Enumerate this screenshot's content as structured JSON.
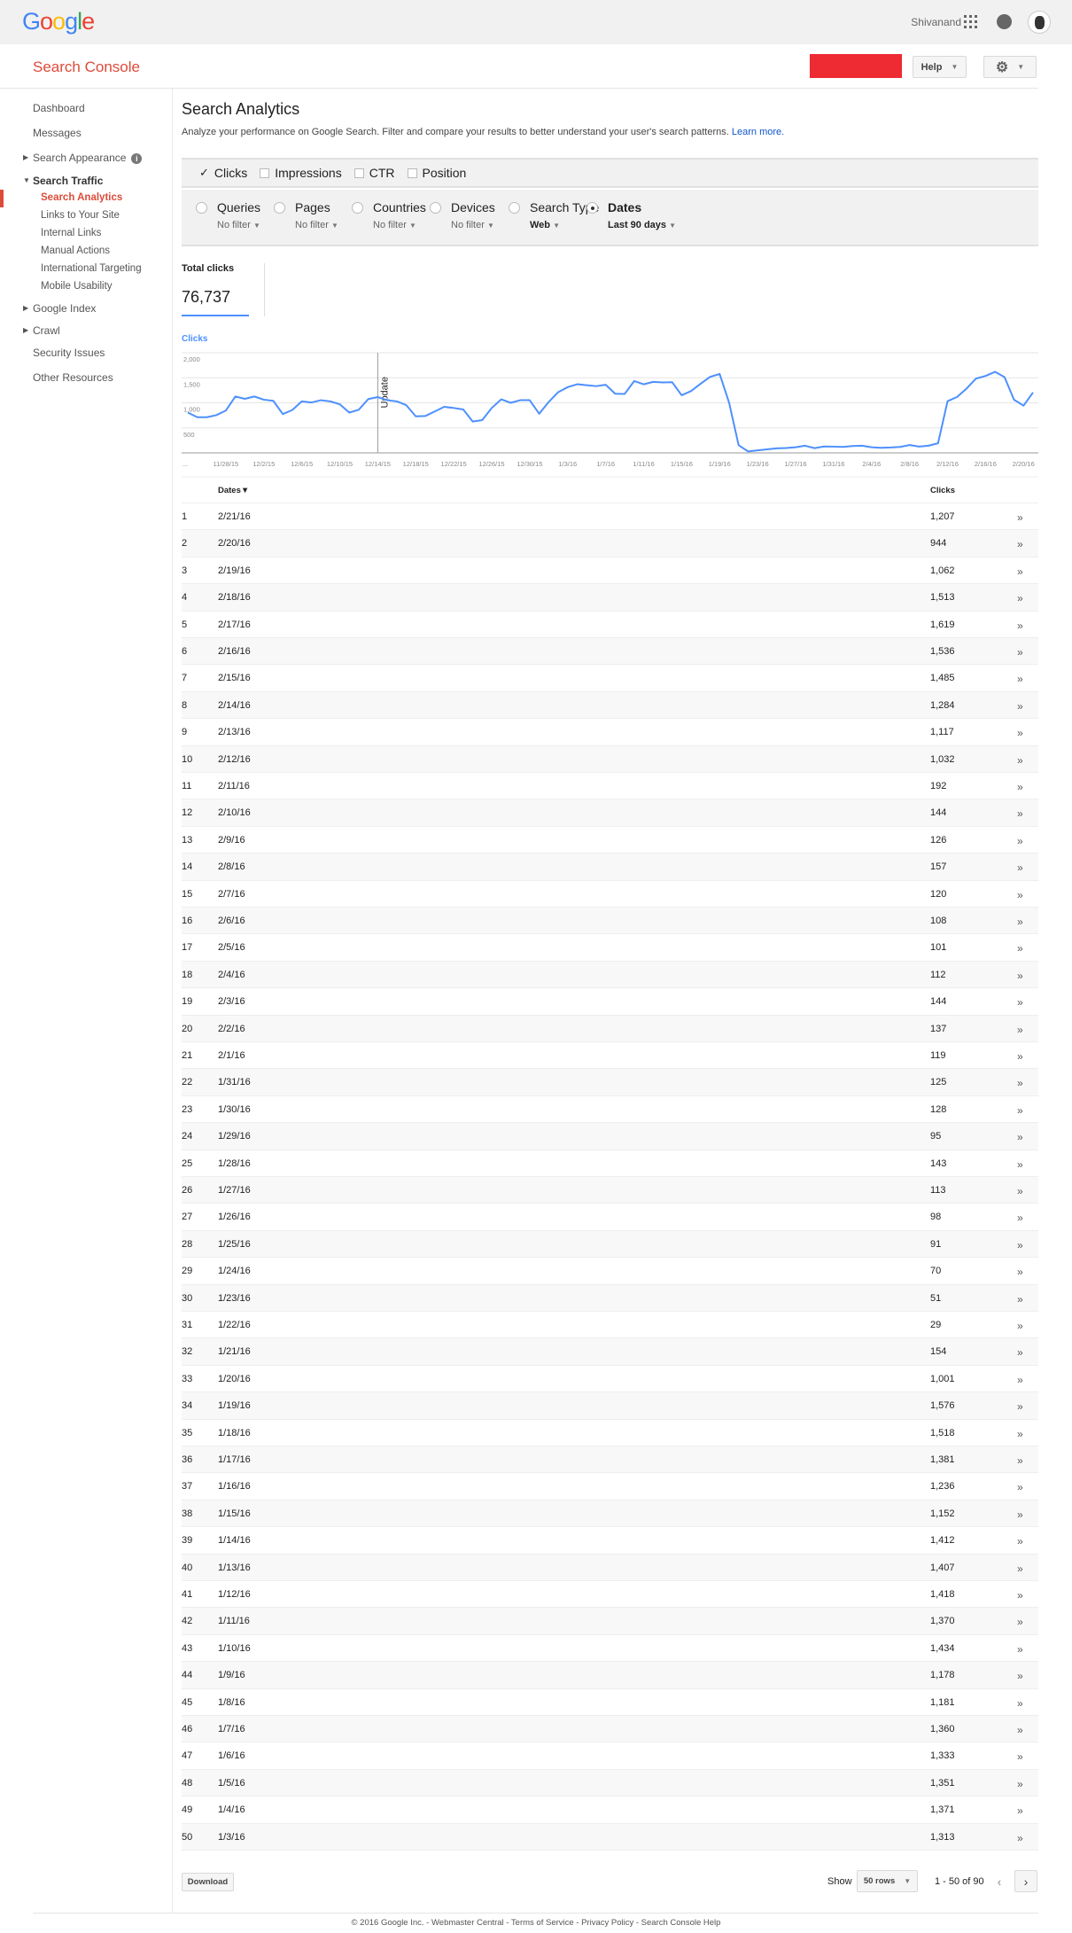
{
  "header": {
    "logo": "Google",
    "user_name": "Shivanand",
    "icons": [
      "apps-grid-icon",
      "notifications-icon",
      "avatar"
    ]
  },
  "console": {
    "title": "Search Console",
    "help_label": "Help",
    "settings_icon": "gear-icon",
    "brand_color": "#dd4b39"
  },
  "sidebar": {
    "dashboard": "Dashboard",
    "messages": "Messages",
    "search_appearance": "Search Appearance",
    "search_traffic": "Search Traffic",
    "traffic_items": [
      "Search Analytics",
      "Links to Your Site",
      "Internal Links",
      "Manual Actions",
      "International Targeting",
      "Mobile Usability"
    ],
    "google_index": "Google Index",
    "crawl": "Crawl",
    "security_issues": "Security Issues",
    "other_resources": "Other Resources"
  },
  "page": {
    "title": "Search Analytics",
    "description": "Analyze your performance on Google Search. Filter and compare your results to better understand your user's search patterns.",
    "learn_more": "Learn more."
  },
  "metrics": [
    {
      "label": "Clicks",
      "checked": true
    },
    {
      "label": "Impressions",
      "checked": false
    },
    {
      "label": "CTR",
      "checked": false
    },
    {
      "label": "Position",
      "checked": false
    }
  ],
  "filters": [
    {
      "label": "Queries",
      "value": "No filter",
      "selected": false
    },
    {
      "label": "Pages",
      "value": "No filter",
      "selected": false
    },
    {
      "label": "Countries",
      "value": "No filter",
      "selected": false
    },
    {
      "label": "Devices",
      "value": "No filter",
      "selected": false
    },
    {
      "label": "Search Type",
      "value": "Web",
      "selected": false
    },
    {
      "label": "Dates",
      "value": "Last 90 days",
      "selected": true
    }
  ],
  "summary": {
    "label": "Total clicks",
    "value": "76,737"
  },
  "chart_data": {
    "type": "line",
    "title": "",
    "series_label": "Clicks",
    "color": "#4d90fe",
    "ylim": [
      0,
      2000
    ],
    "yticks": [
      "2,000",
      "1,500",
      "1,000",
      "500"
    ],
    "grid": true,
    "xtick_first": "...",
    "xticks": [
      "11/28/15",
      "12/2/15",
      "12/6/15",
      "12/10/15",
      "12/14/15",
      "12/18/15",
      "12/22/15",
      "12/26/15",
      "12/30/15",
      "1/3/16",
      "1/7/16",
      "1/11/16",
      "1/15/16",
      "1/19/16",
      "1/23/16",
      "1/27/16",
      "1/31/16",
      "2/4/16",
      "2/8/16",
      "2/12/16",
      "2/16/16",
      "2/20/16"
    ],
    "annotation": {
      "date": "12/14/15",
      "label": "Update"
    },
    "x": [
      "11/24/15",
      "11/25/15",
      "11/26/15",
      "11/27/15",
      "11/28/15",
      "11/29/15",
      "11/30/15",
      "12/1/15",
      "12/2/15",
      "12/3/15",
      "12/4/15",
      "12/5/15",
      "12/6/15",
      "12/7/15",
      "12/8/15",
      "12/9/15",
      "12/10/15",
      "12/11/15",
      "12/12/15",
      "12/13/15",
      "12/14/15",
      "12/15/15",
      "12/16/15",
      "12/17/15",
      "12/18/15",
      "12/19/15",
      "12/20/15",
      "12/21/15",
      "12/22/15",
      "12/23/15",
      "12/24/15",
      "12/25/15",
      "12/26/15",
      "12/27/15",
      "12/28/15",
      "12/29/15",
      "12/30/15",
      "12/31/15",
      "1/1/16",
      "1/2/16",
      "1/3/16",
      "1/4/16",
      "1/5/16",
      "1/6/16",
      "1/7/16",
      "1/8/16",
      "1/9/16",
      "1/10/16",
      "1/11/16",
      "1/12/16",
      "1/13/16",
      "1/14/16",
      "1/15/16",
      "1/16/16",
      "1/17/16",
      "1/18/16",
      "1/19/16",
      "1/20/16",
      "1/21/16",
      "1/22/16",
      "1/23/16",
      "1/24/16",
      "1/25/16",
      "1/26/16",
      "1/27/16",
      "1/28/16",
      "1/29/16",
      "1/30/16",
      "1/31/16",
      "2/1/16",
      "2/2/16",
      "2/3/16",
      "2/4/16",
      "2/5/16",
      "2/6/16",
      "2/7/16",
      "2/8/16",
      "2/9/16",
      "2/10/16",
      "2/11/16",
      "2/12/16",
      "2/13/16",
      "2/14/16",
      "2/15/16",
      "2/16/16",
      "2/17/16",
      "2/18/16",
      "2/19/16",
      "2/20/16",
      "2/21/16"
    ],
    "values": [
      805,
      713,
      713,
      753,
      845,
      1126,
      1080,
      1126,
      1063,
      1040,
      776,
      856,
      1029,
      1006,
      1052,
      1029,
      971,
      805,
      862,
      1075,
      1115,
      1052,
      1029,
      954,
      730,
      736,
      828,
      920,
      897,
      868,
      626,
      655,
      897,
      1069,
      1000,
      1052,
      1052,
      782,
      1017,
      1213,
      1313,
      1371,
      1351,
      1333,
      1360,
      1181,
      1178,
      1434,
      1370,
      1418,
      1407,
      1412,
      1152,
      1236,
      1381,
      1518,
      1576,
      1001,
      154,
      29,
      51,
      70,
      91,
      98,
      113,
      143,
      95,
      128,
      125,
      119,
      137,
      144,
      112,
      101,
      108,
      120,
      157,
      126,
      144,
      192,
      1032,
      1117,
      1284,
      1485,
      1536,
      1619,
      1513,
      1062,
      944,
      1207
    ]
  },
  "table": {
    "headers": {
      "dates": "Dates▼",
      "clicks": "Clicks"
    },
    "row_action_icon": "»",
    "rows": [
      [
        "1",
        "2/21/16",
        "1,207"
      ],
      [
        "2",
        "2/20/16",
        "944"
      ],
      [
        "3",
        "2/19/16",
        "1,062"
      ],
      [
        "4",
        "2/18/16",
        "1,513"
      ],
      [
        "5",
        "2/17/16",
        "1,619"
      ],
      [
        "6",
        "2/16/16",
        "1,536"
      ],
      [
        "7",
        "2/15/16",
        "1,485"
      ],
      [
        "8",
        "2/14/16",
        "1,284"
      ],
      [
        "9",
        "2/13/16",
        "1,117"
      ],
      [
        "10",
        "2/12/16",
        "1,032"
      ],
      [
        "11",
        "2/11/16",
        "192"
      ],
      [
        "12",
        "2/10/16",
        "144"
      ],
      [
        "13",
        "2/9/16",
        "126"
      ],
      [
        "14",
        "2/8/16",
        "157"
      ],
      [
        "15",
        "2/7/16",
        "120"
      ],
      [
        "16",
        "2/6/16",
        "108"
      ],
      [
        "17",
        "2/5/16",
        "101"
      ],
      [
        "18",
        "2/4/16",
        "112"
      ],
      [
        "19",
        "2/3/16",
        "144"
      ],
      [
        "20",
        "2/2/16",
        "137"
      ],
      [
        "21",
        "2/1/16",
        "119"
      ],
      [
        "22",
        "1/31/16",
        "125"
      ],
      [
        "23",
        "1/30/16",
        "128"
      ],
      [
        "24",
        "1/29/16",
        "95"
      ],
      [
        "25",
        "1/28/16",
        "143"
      ],
      [
        "26",
        "1/27/16",
        "113"
      ],
      [
        "27",
        "1/26/16",
        "98"
      ],
      [
        "28",
        "1/25/16",
        "91"
      ],
      [
        "29",
        "1/24/16",
        "70"
      ],
      [
        "30",
        "1/23/16",
        "51"
      ],
      [
        "31",
        "1/22/16",
        "29"
      ],
      [
        "32",
        "1/21/16",
        "154"
      ],
      [
        "33",
        "1/20/16",
        "1,001"
      ],
      [
        "34",
        "1/19/16",
        "1,576"
      ],
      [
        "35",
        "1/18/16",
        "1,518"
      ],
      [
        "36",
        "1/17/16",
        "1,381"
      ],
      [
        "37",
        "1/16/16",
        "1,236"
      ],
      [
        "38",
        "1/15/16",
        "1,152"
      ],
      [
        "39",
        "1/14/16",
        "1,412"
      ],
      [
        "40",
        "1/13/16",
        "1,407"
      ],
      [
        "41",
        "1/12/16",
        "1,418"
      ],
      [
        "42",
        "1/11/16",
        "1,370"
      ],
      [
        "43",
        "1/10/16",
        "1,434"
      ],
      [
        "44",
        "1/9/16",
        "1,178"
      ],
      [
        "45",
        "1/8/16",
        "1,181"
      ],
      [
        "46",
        "1/7/16",
        "1,360"
      ],
      [
        "47",
        "1/6/16",
        "1,333"
      ],
      [
        "48",
        "1/5/16",
        "1,351"
      ],
      [
        "49",
        "1/4/16",
        "1,371"
      ],
      [
        "50",
        "1/3/16",
        "1,313"
      ]
    ]
  },
  "pagination": {
    "download": "Download",
    "show": "Show",
    "rows_option": "50 rows",
    "range": "1 - 50 of 90",
    "prev": "‹",
    "next": "›"
  },
  "footer": {
    "text": "© 2016 Google Inc. - Webmaster Central - Terms of Service - Privacy Policy - Search Console Help"
  }
}
